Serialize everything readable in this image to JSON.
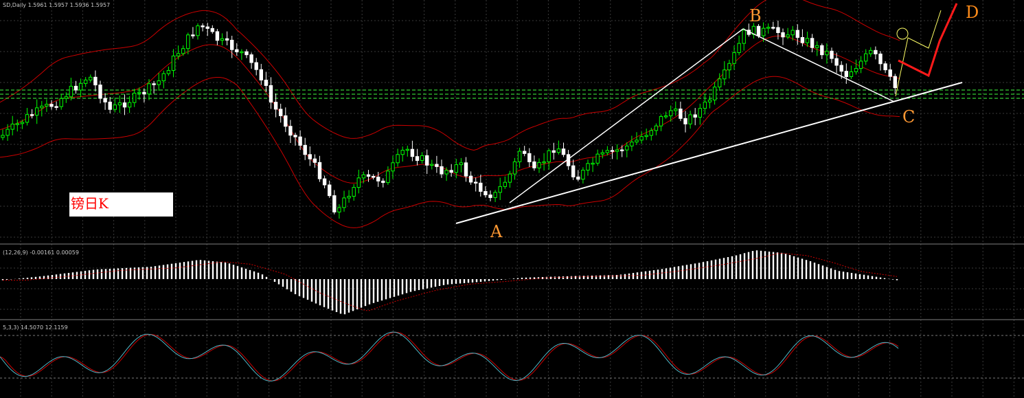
{
  "header": {
    "main": "SD,Daily  1.5961 1.5957 1.5936 1.5957",
    "macd": "(12,26,9) -0.00161 0.00059",
    "stoch": "5,3,3) 14.5070 12.1159"
  },
  "caption": "镑日K",
  "points": [
    {
      "label": "A",
      "color": "#ff9933"
    },
    {
      "label": "B",
      "color": "#ff9933"
    },
    {
      "label": "C",
      "color": "#ff9933"
    },
    {
      "label": "D",
      "color": "#ff8c1a"
    }
  ],
  "colors": {
    "background": "#000000",
    "grid": "#3a3a3a",
    "bull_candle": "#00ff00",
    "bear_candle": "#ffffff",
    "bollinger": "#cc0000",
    "support_lines": "#33cc33",
    "macd_hist": "#ffffff",
    "macd_signal": "#cc0000",
    "stoch_k": "#4fb8c8",
    "stoch_d": "#cc0000",
    "forecast_thin": "#ffff66",
    "forecast_thick": "#ff1a1a"
  },
  "chart_data": [
    {
      "type": "candlestick",
      "title": "SD,Daily",
      "readout": {
        "open": 1.5961,
        "high": 1.5957,
        "low": 1.5936,
        "close": 1.5957
      },
      "overlays": [
        "Bollinger Bands"
      ],
      "trendlines": [
        "A-B",
        "B-C",
        "A-C",
        "C-D forecast"
      ]
    },
    {
      "type": "bar",
      "title": "MACD",
      "params": [
        12,
        26,
        9
      ],
      "values": [
        -0.00161,
        0.00059
      ]
    },
    {
      "type": "line",
      "title": "Stochastic",
      "params": [
        5,
        3,
        3
      ],
      "values": [
        14.507,
        12.1159
      ]
    }
  ]
}
